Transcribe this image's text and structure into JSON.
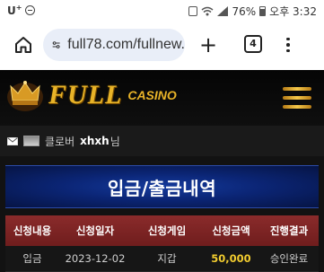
{
  "status_bar": {
    "carrier": "U",
    "carrier_sup": "+",
    "battery": "76%",
    "time": "오후 3:32"
  },
  "browser": {
    "url": "full78.com/fullnew.",
    "tab_count": "4",
    "icons": [
      "home-icon",
      "site-info-icon",
      "new-tab-icon",
      "tab-switcher-icon",
      "more-menu-icon"
    ]
  },
  "site": {
    "logo_main": "FULL",
    "logo_sub": "CASINO",
    "user": {
      "grade": "클로버",
      "name": "xhxh",
      "suffix": "님"
    },
    "page_title": "입금/출금내역",
    "table": {
      "headers": [
        "신청내용",
        "신청일자",
        "신청게임",
        "신청금액",
        "진행결과"
      ],
      "rows": [
        [
          "입금",
          "2023-12-02",
          "지갑",
          "50,000",
          "승인완료"
        ]
      ]
    },
    "colors": {
      "gold": "#e8b328",
      "header_red": "#8a2b2b",
      "banner_blue": "#0b2575",
      "amount_yellow": "#f2cc2f"
    }
  }
}
